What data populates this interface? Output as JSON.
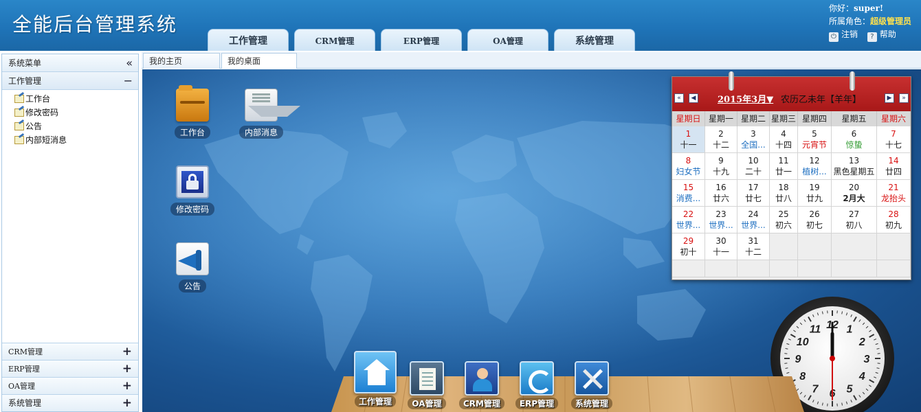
{
  "header": {
    "title": "全能后台管理系统",
    "nav_tabs": [
      "工作管理",
      "CRM管理",
      "ERP管理",
      "OA管理",
      "系统管理"
    ],
    "user": {
      "greeting_label": "你好：",
      "username": "super!",
      "role_label": "所属角色：",
      "role_value": "超级管理员",
      "logout_label": "注销",
      "help_label": "帮助"
    }
  },
  "sidebar": {
    "title": "系统菜单",
    "collapse_glyph": "«",
    "expanded_section": {
      "label": "工作管理",
      "toggle": "−",
      "items": [
        "工作台",
        "修改密码",
        "公告",
        "内部短消息"
      ]
    },
    "collapsed_sections": [
      "CRM管理",
      "ERP管理",
      "OA管理",
      "系统管理"
    ],
    "expand_glyph": "+"
  },
  "content_tabs": [
    "我的主页",
    "我的桌面"
  ],
  "desktop": {
    "icons": [
      {
        "label": "工作台",
        "icon": "folder-icon"
      },
      {
        "label": "内部消息",
        "icon": "mail-icon"
      },
      {
        "label": "修改密码",
        "icon": "lock-icon"
      },
      {
        "label": "公告",
        "icon": "megaphone-icon"
      }
    ]
  },
  "calendar": {
    "month_label": "2015年3月▼",
    "lunar_label": "农历乙未年【羊年】",
    "nav_prev_year": "«",
    "nav_prev_month": "◀",
    "nav_next_month": "▶",
    "nav_next_year": "»",
    "weekdays": [
      "星期日",
      "星期一",
      "星期二",
      "星期三",
      "星期四",
      "星期五",
      "星期六"
    ],
    "weeks": [
      [
        {
          "d": "1",
          "l": "十一",
          "today": true
        },
        {
          "d": "2",
          "l": "十二"
        },
        {
          "d": "3",
          "l": "全国...",
          "lc": "blue"
        },
        {
          "d": "4",
          "l": "十四"
        },
        {
          "d": "5",
          "l": "元宵节",
          "lc": "red"
        },
        {
          "d": "6",
          "l": "惊蛰",
          "lc": "green"
        },
        {
          "d": "7",
          "l": "十七"
        }
      ],
      [
        {
          "d": "8",
          "l": "妇女节",
          "lc": "blue"
        },
        {
          "d": "9",
          "l": "十九"
        },
        {
          "d": "10",
          "l": "二十"
        },
        {
          "d": "11",
          "l": "廿一"
        },
        {
          "d": "12",
          "l": "植树...",
          "lc": "blue"
        },
        {
          "d": "13",
          "l": "黑色星期五"
        },
        {
          "d": "14",
          "l": "廿四"
        }
      ],
      [
        {
          "d": "15",
          "l": "消费...",
          "lc": "blue"
        },
        {
          "d": "16",
          "l": "廿六"
        },
        {
          "d": "17",
          "l": "廿七"
        },
        {
          "d": "18",
          "l": "廿八"
        },
        {
          "d": "19",
          "l": "廿九"
        },
        {
          "d": "20",
          "l": "2月大",
          "lc": "bold"
        },
        {
          "d": "21",
          "l": "龙抬头",
          "lc": "red"
        }
      ],
      [
        {
          "d": "22",
          "l": "世界...",
          "lc": "blue"
        },
        {
          "d": "23",
          "l": "世界...",
          "lc": "blue"
        },
        {
          "d": "24",
          "l": "世界...",
          "lc": "blue"
        },
        {
          "d": "25",
          "l": "初六"
        },
        {
          "d": "26",
          "l": "初七"
        },
        {
          "d": "27",
          "l": "初八"
        },
        {
          "d": "28",
          "l": "初九"
        }
      ],
      [
        {
          "d": "29",
          "l": "初十"
        },
        {
          "d": "30",
          "l": "十一"
        },
        {
          "d": "31",
          "l": "十二"
        },
        null,
        null,
        null,
        null
      ]
    ]
  },
  "clock": {
    "numerals": [
      "12",
      "1",
      "2",
      "3",
      "4",
      "5",
      "6",
      "7",
      "8",
      "9",
      "10",
      "11"
    ],
    "hour": 12,
    "minute": 0,
    "second": 30
  },
  "dock": {
    "items": [
      {
        "label": "工作管理",
        "icon": "home-icon"
      },
      {
        "label": "OA管理",
        "icon": "document-icon"
      },
      {
        "label": "CRM管理",
        "icon": "user-icon"
      },
      {
        "label": "ERP管理",
        "icon": "cycle-icon"
      },
      {
        "label": "系统管理",
        "icon": "tools-icon"
      }
    ]
  }
}
